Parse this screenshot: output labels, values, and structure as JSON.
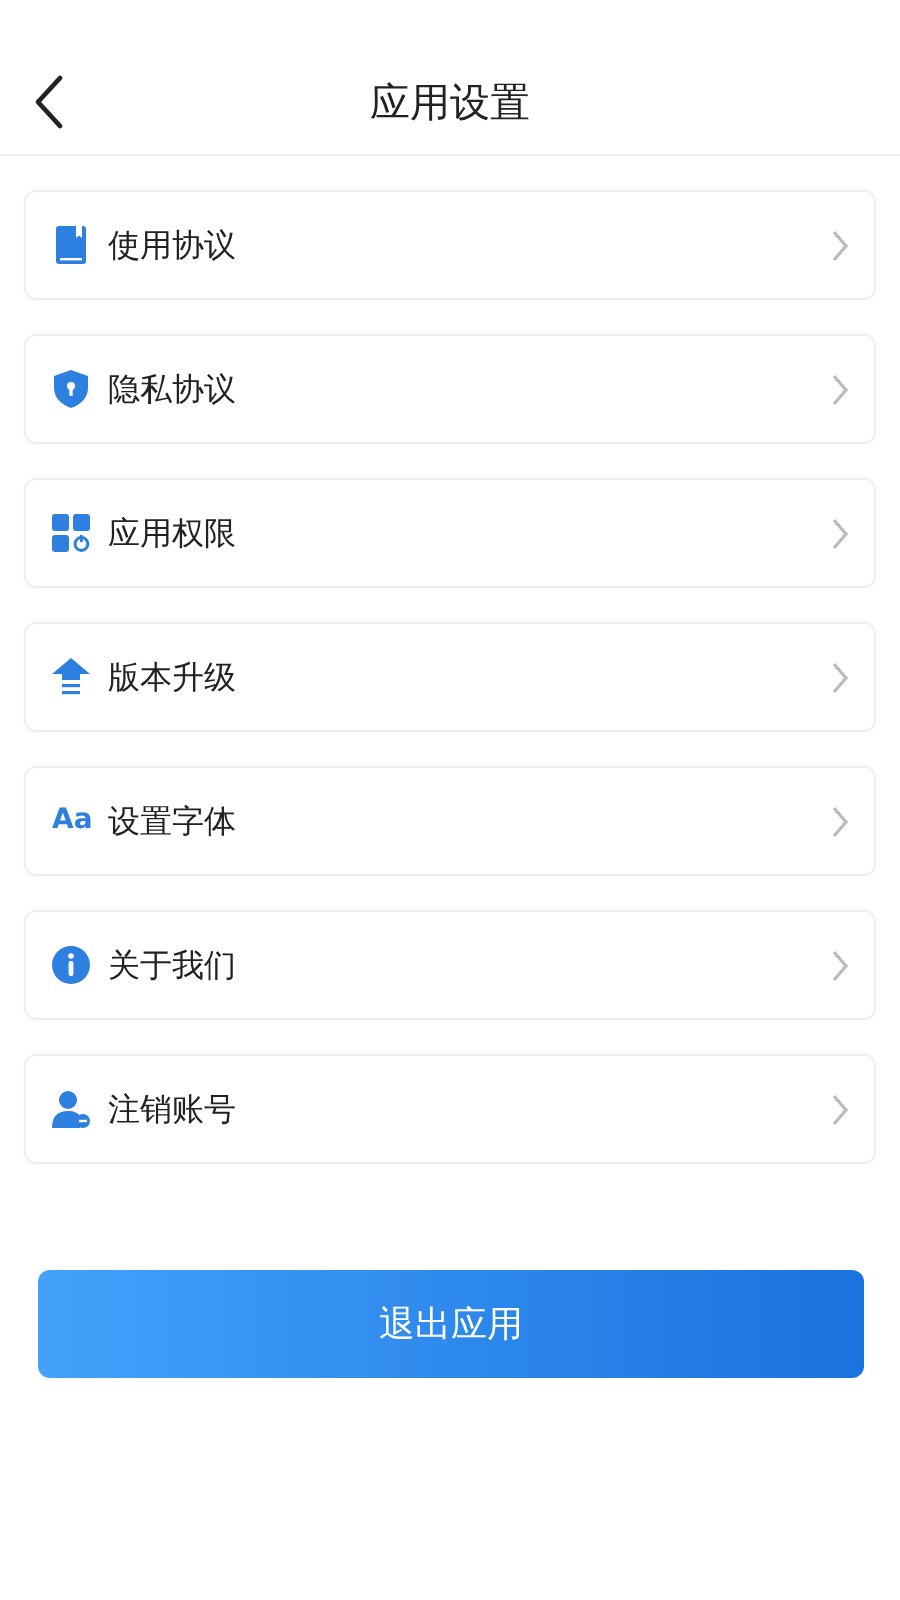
{
  "header": {
    "title": "应用设置"
  },
  "items": [
    {
      "kind": "book",
      "label": "使用协议"
    },
    {
      "kind": "shield",
      "label": "隐私协议"
    },
    {
      "kind": "grid",
      "label": "应用权限"
    },
    {
      "kind": "upgrade",
      "label": "版本升级"
    },
    {
      "kind": "font",
      "icon_text": "Aa",
      "label": "设置字体"
    },
    {
      "kind": "info",
      "label": "关于我们"
    },
    {
      "kind": "user",
      "label": "注销账号"
    }
  ],
  "button": "退出应用"
}
